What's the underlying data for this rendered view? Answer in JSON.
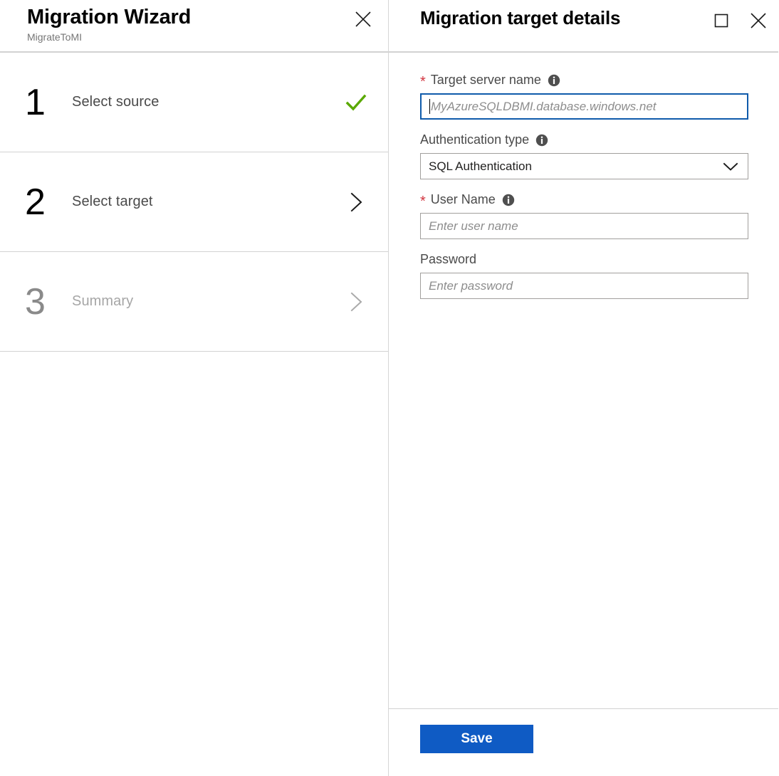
{
  "wizard": {
    "title": "Migration Wizard",
    "subtitle": "MigrateToMI",
    "close_icon": "close-icon",
    "steps": [
      {
        "number": "1",
        "label": "Select source",
        "status_icon": "check-icon",
        "state": "complete"
      },
      {
        "number": "2",
        "label": "Select target",
        "status_icon": "chevron-right-icon",
        "state": "active"
      },
      {
        "number": "3",
        "label": "Summary",
        "status_icon": "chevron-right-icon",
        "state": "disabled"
      }
    ]
  },
  "details": {
    "title": "Migration target details",
    "maximize_icon": "maximize-icon",
    "close_icon": "close-icon",
    "fields": {
      "target_server": {
        "label": "Target server name",
        "required_marker": "*",
        "info_icon": "info-icon",
        "value": "",
        "placeholder": "MyAzureSQLDBMI.database.windows.net",
        "focused": true
      },
      "auth_type": {
        "label": "Authentication type",
        "info_icon": "info-icon",
        "selected": "SQL Authentication",
        "chevron_icon": "chevron-down-icon"
      },
      "user_name": {
        "label": "User Name",
        "required_marker": "*",
        "info_icon": "info-icon",
        "value": "",
        "placeholder": "Enter user name"
      },
      "password": {
        "label": "Password",
        "value": "",
        "placeholder": "Enter password"
      }
    },
    "footer": {
      "save_label": "Save"
    }
  },
  "colors": {
    "accent_blue": "#0f5bc4",
    "focus_blue": "#0f5bab",
    "required_red": "#d1343f",
    "success_green": "#5aa902",
    "border_gray": "#a19f9d",
    "divider_gray": "#d2d2d2"
  }
}
